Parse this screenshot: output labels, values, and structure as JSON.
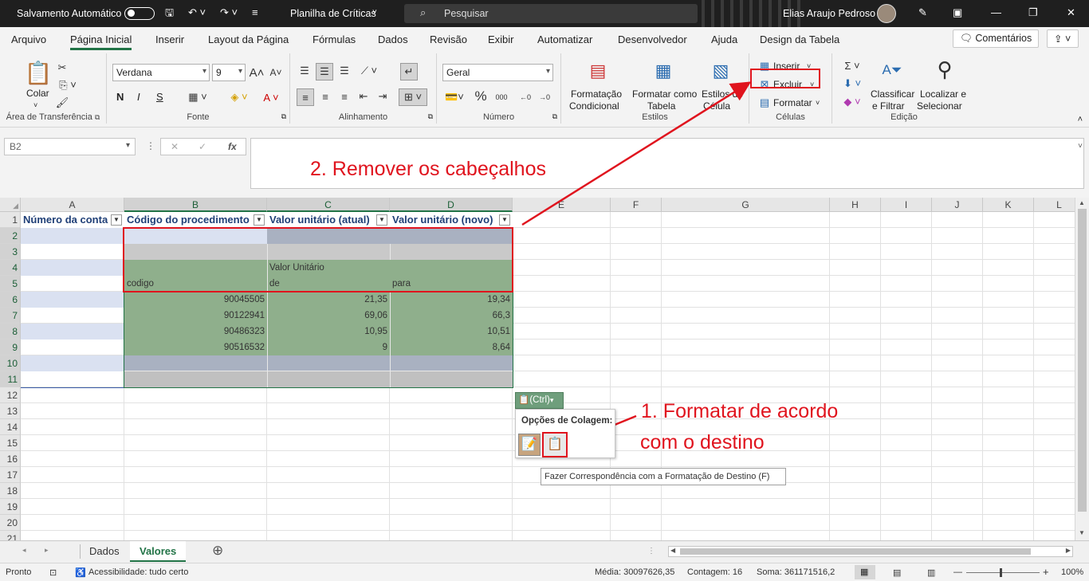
{
  "titlebar": {
    "autosave_label": "Salvamento Automático",
    "doc_title": "Planilha de Críticas",
    "search_placeholder": "Pesquisar",
    "user_name": "Elias Araujo Pedroso"
  },
  "menu": {
    "tabs": [
      "Arquivo",
      "Página Inicial",
      "Inserir",
      "Layout da Página",
      "Fórmulas",
      "Dados",
      "Revisão",
      "Exibir",
      "Automatizar",
      "Desenvolvedor",
      "Ajuda",
      "Design da Tabela"
    ],
    "active_tab": "Página Inicial",
    "comments_label": "Comentários"
  },
  "ribbon": {
    "clipboard": {
      "paste_label": "Colar",
      "group_label": "Área de Transferência"
    },
    "font": {
      "font_name": "Verdana",
      "font_size": "9",
      "bold": "N",
      "italic": "I",
      "underline": "S",
      "group_label": "Fonte"
    },
    "alignment": {
      "group_label": "Alinhamento"
    },
    "number": {
      "format": "Geral",
      "group_label": "Número"
    },
    "styles": {
      "conditional_l1": "Formatação",
      "conditional_l2": "Condicional",
      "table_l1": "Formatar como",
      "table_l2": "Tabela",
      "cell_l1": "Estilos de",
      "cell_l2": "Célula",
      "group_label": "Estilos"
    },
    "cells": {
      "insert": "Inserir",
      "delete": "Excluir",
      "format": "Formatar",
      "group_label": "Células"
    },
    "editing": {
      "sort_l1": "Classificar",
      "sort_l2": "e Filtrar",
      "find_l1": "Localizar e",
      "find_l2": "Selecionar",
      "group_label": "Edição"
    }
  },
  "formula_bar": {
    "name_box": "B2",
    "fx": "fx"
  },
  "annotations": {
    "step2": "2. Remover os cabeçalhos",
    "step1_l1": "1. Formatar de acordo",
    "step1_l2": "com o destino"
  },
  "grid": {
    "columns": [
      "A",
      "B",
      "C",
      "D",
      "E",
      "F",
      "G",
      "H",
      "I",
      "J",
      "K",
      "L"
    ],
    "rows": [
      "1",
      "2",
      "3",
      "4",
      "5",
      "6",
      "7",
      "8",
      "9",
      "10",
      "11",
      "12",
      "13",
      "14",
      "15",
      "16",
      "17",
      "18",
      "19",
      "20",
      "21"
    ],
    "headers": [
      "Número da conta",
      "Código do procedimento",
      "Valor unitário (atual)",
      "Valor unitário (novo)"
    ],
    "pasted": {
      "valor_unitario": "Valor Unitário",
      "codigo": "codigo",
      "de": "de",
      "para": "para",
      "data": [
        [
          "90045505",
          "21,35",
          "19,34"
        ],
        [
          "90122941",
          "69,06",
          "66,3"
        ],
        [
          "90486323",
          "10,95",
          "10,51"
        ],
        [
          "90516532",
          "9",
          "8,64"
        ]
      ]
    }
  },
  "paste_popup": {
    "ctrl_label": "(Ctrl)",
    "title": "Opções de Colagem:",
    "tooltip": "Fazer Correspondência com a Formatação de Destino (F)"
  },
  "sheets": {
    "tabs": [
      "Dados",
      "Valores"
    ],
    "active": "Valores"
  },
  "status": {
    "ready": "Pronto",
    "accessibility": "Acessibilidade: tudo certo",
    "average": "Média: 30097626,35",
    "count": "Contagem: 16",
    "sum": "Soma: 361171516,2",
    "zoom": "100%"
  },
  "colors": {
    "accent": "#217346",
    "annotation_red": "#e0141e",
    "paste_green": "#8faf8c",
    "band_blue": "#dae1f1"
  }
}
